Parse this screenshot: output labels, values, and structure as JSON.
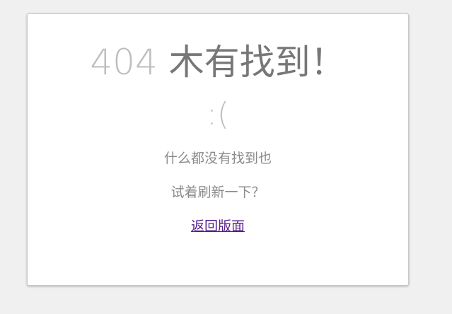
{
  "error": {
    "code": "404",
    "message": "木有找到！",
    "face": ":(",
    "line1": "什么都没有找到也",
    "line2": "试着刷新一下？",
    "back_link": "返回版面"
  },
  "colors": {
    "page_bg": "#f0f0f0",
    "card_bg": "#ffffff",
    "code": "#bdbdbd",
    "message": "#777777",
    "link": "#551a8b"
  }
}
